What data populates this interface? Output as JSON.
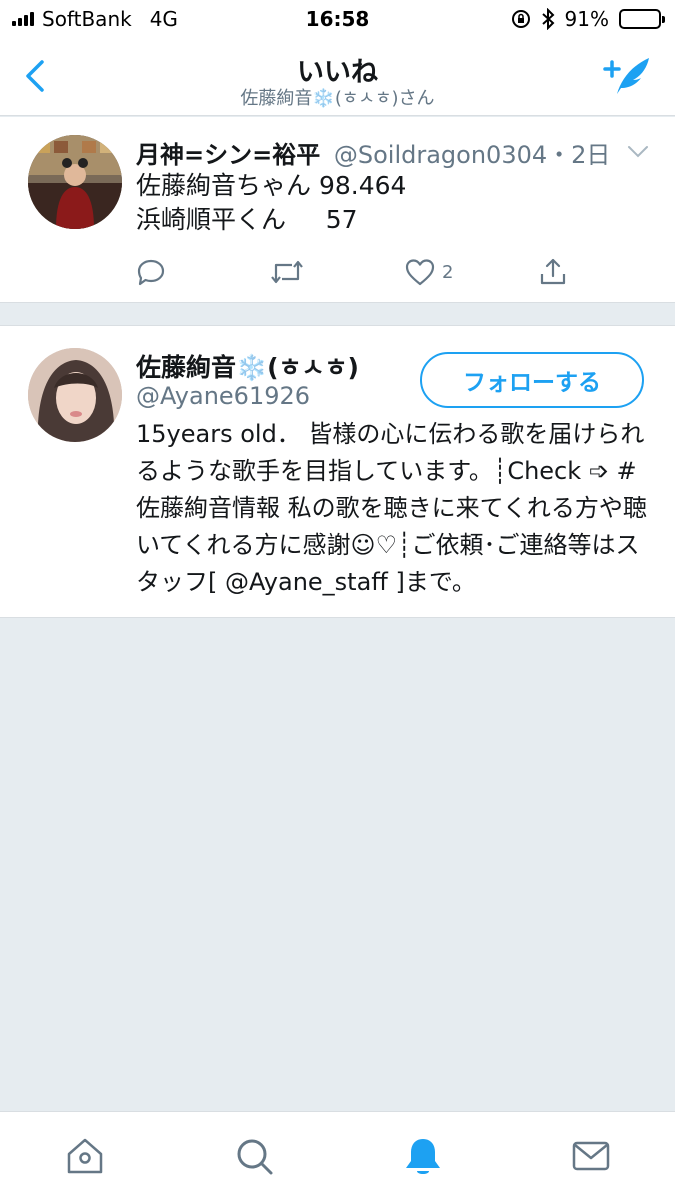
{
  "status_bar": {
    "carrier": "SoftBank",
    "network": "4G",
    "time": "16:58",
    "battery": "91%",
    "battery_level": 0.91,
    "battery_color": "#f5c518"
  },
  "header": {
    "title": "いいね",
    "subtitle": "佐藤絢音❄️(ㅎㅅㅎ)さん",
    "back_icon": "chevron-left-icon",
    "compose_icon": "compose-tweet-icon"
  },
  "tweet": {
    "author_name": "月神=シン=裕平",
    "author_handle": "@Soildragon0304",
    "time": "・2日",
    "lines": [
      "佐藤絢音ちゃん 98.464",
      "浜崎順平くん     57"
    ],
    "reply_count": "",
    "retweet_count": "",
    "like_count": "2"
  },
  "profile": {
    "name": "佐藤絢音❄️(ㅎㅅㅎ)",
    "handle": "@Ayane61926",
    "follow_label": "フォローする",
    "bio": "15years old． 皆様の心に伝わる歌を届けられるような歌手を目指しています。┊Check ➩ #佐藤絢音情報 私の歌を聴きに来てくれる方や聴いてくれる方に感謝☺♡┊ご依頼･ご連絡等はスタッフ[ @Ayane_staff ]まで。"
  },
  "tabbar": {
    "tabs": [
      {
        "icon": "home-icon",
        "active": false
      },
      {
        "icon": "search-icon",
        "active": false
      },
      {
        "icon": "notifications-bell-icon",
        "active": true
      },
      {
        "icon": "messages-envelope-icon",
        "active": false
      }
    ]
  },
  "colors": {
    "accent": "#1da1f2",
    "muted": "#657786",
    "background": "#e6ecf0"
  }
}
